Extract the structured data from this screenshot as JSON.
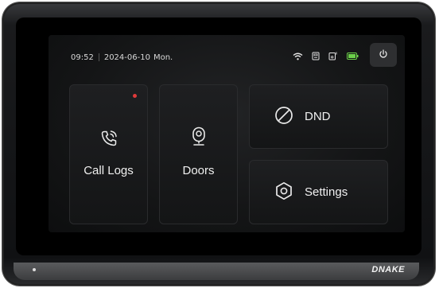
{
  "status": {
    "time": "09:52",
    "date": "2024-06-10",
    "weekday": "Mon."
  },
  "status_icons": [
    "wifi-icon",
    "sd-card-icon",
    "device-storage-icon",
    "battery-icon"
  ],
  "tiles": {
    "call_logs": {
      "label": "Call Logs",
      "icon": "phone-icon",
      "has_notification": true
    },
    "doors": {
      "label": "Doors",
      "icon": "camera-icon"
    },
    "dnd": {
      "label": "DND",
      "icon": "prohibit-icon"
    },
    "settings": {
      "label": "Settings",
      "icon": "hexagon-gear-icon"
    }
  },
  "brand": "DNAKE",
  "colors": {
    "notification": "#e03a3a",
    "battery": "#6cd04a",
    "text": "#f0f0f0"
  }
}
